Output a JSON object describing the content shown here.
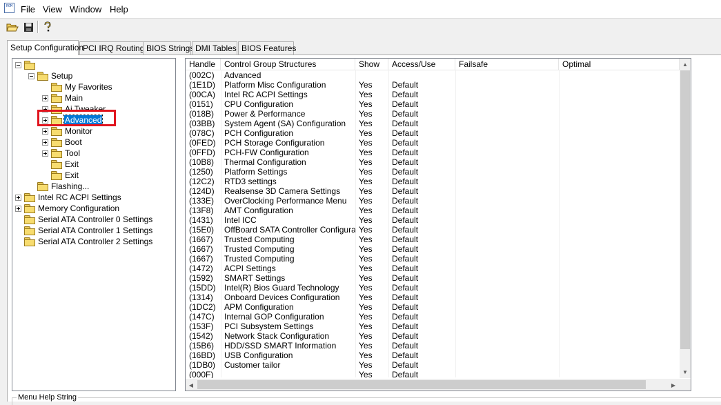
{
  "app": {
    "icon_label": "ROM"
  },
  "menu": {
    "items": [
      "File",
      "View",
      "Window",
      "Help"
    ]
  },
  "toolbar": {
    "icons": [
      "open-folder-icon",
      "save-disk-icon",
      "help-question-icon"
    ]
  },
  "tabs": [
    {
      "label": "Setup Configuration",
      "active": true
    },
    {
      "label": "PCI IRQ Routing",
      "active": false
    },
    {
      "label": "BIOS Strings",
      "active": false
    },
    {
      "label": "DMI Tables",
      "active": false
    },
    {
      "label": "BIOS Features",
      "active": false
    }
  ],
  "tree": {
    "nodes": [
      {
        "label": "",
        "level": 0,
        "expander": "minus"
      },
      {
        "label": "Setup",
        "level": 1,
        "expander": "minus"
      },
      {
        "label": "My Favorites",
        "level": 2,
        "expander": "none"
      },
      {
        "label": "Main",
        "level": 2,
        "expander": "plus"
      },
      {
        "label": "Ai Tweaker",
        "level": 2,
        "expander": "plus"
      },
      {
        "label": "Advanced",
        "level": 2,
        "expander": "plus",
        "selected": true
      },
      {
        "label": "Monitor",
        "level": 2,
        "expander": "plus"
      },
      {
        "label": "Boot",
        "level": 2,
        "expander": "plus"
      },
      {
        "label": "Tool",
        "level": 2,
        "expander": "plus"
      },
      {
        "label": "Exit",
        "level": 2,
        "expander": "none"
      },
      {
        "label": "Exit",
        "level": 2,
        "expander": "none"
      },
      {
        "label": "Flashing...",
        "level": 1,
        "expander": "none"
      },
      {
        "label": "Intel RC ACPI Settings",
        "level": 0,
        "expander": "plus"
      },
      {
        "label": "Memory Configuration",
        "level": 0,
        "expander": "plus"
      },
      {
        "label": "Serial ATA Controller 0 Settings",
        "level": 0,
        "expander": "none"
      },
      {
        "label": "Serial ATA Controller 1 Settings",
        "level": 0,
        "expander": "none"
      },
      {
        "label": "Serial ATA Controller 2 Settings",
        "level": 0,
        "expander": "none"
      }
    ]
  },
  "grid": {
    "columns": [
      "Handle",
      "Control Group Structures",
      "Show",
      "Access/Use",
      "Failsafe",
      "Optimal"
    ],
    "rows": [
      [
        "(002C)",
        "Advanced",
        "",
        "",
        "",
        ""
      ],
      [
        "(1E1D)",
        "Platform Misc Configuration",
        "Yes",
        "Default",
        "",
        ""
      ],
      [
        "(00CA)",
        "Intel RC ACPI Settings",
        "Yes",
        "Default",
        "",
        ""
      ],
      [
        "(0151)",
        "CPU Configuration",
        "Yes",
        "Default",
        "",
        ""
      ],
      [
        "(018B)",
        "Power & Performance",
        "Yes",
        "Default",
        "",
        ""
      ],
      [
        "(03BB)",
        "System Agent (SA) Configuration",
        "Yes",
        "Default",
        "",
        ""
      ],
      [
        "(078C)",
        "PCH Configuration",
        "Yes",
        "Default",
        "",
        ""
      ],
      [
        "(0FED)",
        "PCH Storage Configuration",
        "Yes",
        "Default",
        "",
        ""
      ],
      [
        "(0FFD)",
        "PCH-FW Configuration",
        "Yes",
        "Default",
        "",
        ""
      ],
      [
        "(10B8)",
        "Thermal Configuration",
        "Yes",
        "Default",
        "",
        ""
      ],
      [
        "(1250)",
        "Platform Settings",
        "Yes",
        "Default",
        "",
        ""
      ],
      [
        "(12C2)",
        "RTD3 settings",
        "Yes",
        "Default",
        "",
        ""
      ],
      [
        "(124D)",
        "Realsense 3D Camera Settings",
        "Yes",
        "Default",
        "",
        ""
      ],
      [
        "(133E)",
        "OverClocking Performance Menu",
        "Yes",
        "Default",
        "",
        ""
      ],
      [
        "(13F8)",
        "AMT Configuration",
        "Yes",
        "Default",
        "",
        ""
      ],
      [
        "(1431)",
        "Intel ICC",
        "Yes",
        "Default",
        "",
        ""
      ],
      [
        "(15E0)",
        "OffBoard SATA Controller Configurati...",
        "Yes",
        "Default",
        "",
        ""
      ],
      [
        "(1667)",
        "Trusted Computing",
        "Yes",
        "Default",
        "",
        ""
      ],
      [
        "(1667)",
        "Trusted Computing",
        "Yes",
        "Default",
        "",
        ""
      ],
      [
        "(1667)",
        "Trusted Computing",
        "Yes",
        "Default",
        "",
        ""
      ],
      [
        "(1472)",
        "ACPI Settings",
        "Yes",
        "Default",
        "",
        ""
      ],
      [
        "(1592)",
        "SMART Settings",
        "Yes",
        "Default",
        "",
        ""
      ],
      [
        "(15DD)",
        "Intel(R) Bios Guard Technology",
        "Yes",
        "Default",
        "",
        ""
      ],
      [
        "(1314)",
        "Onboard Devices Configuration",
        "Yes",
        "Default",
        "",
        ""
      ],
      [
        "(1DC2)",
        "APM Configuration",
        "Yes",
        "Default",
        "",
        ""
      ],
      [
        "(147C)",
        "Internal GOP Configuration",
        "Yes",
        "Default",
        "",
        ""
      ],
      [
        "(153F)",
        "PCI Subsystem Settings",
        "Yes",
        "Default",
        "",
        ""
      ],
      [
        "(1542)",
        "Network Stack Configuration",
        "Yes",
        "Default",
        "",
        ""
      ],
      [
        "(15B6)",
        "HDD/SSD SMART Information",
        "Yes",
        "Default",
        "",
        ""
      ],
      [
        "(16BD)",
        "USB Configuration",
        "Yes",
        "Default",
        "",
        ""
      ],
      [
        "(1DB0)",
        "Customer tailor",
        "Yes",
        "Default",
        "",
        ""
      ],
      [
        "(000F)",
        "",
        "Yes",
        "Default",
        "",
        ""
      ]
    ]
  },
  "help": {
    "legend": "Menu Help String"
  },
  "colors": {
    "highlight_box": "#e0141e",
    "selection": "#0078d7"
  }
}
